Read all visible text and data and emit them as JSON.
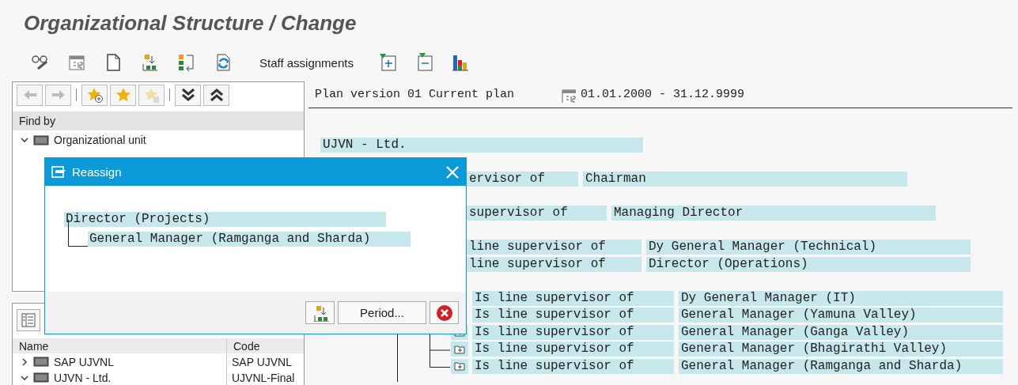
{
  "window": {
    "title": "Organizational Structure / Change"
  },
  "toolbar": {
    "staff_assignments": "Staff assignments"
  },
  "nav_buttons": [
    {
      "kind": "back",
      "disabled": true
    },
    {
      "kind": "forward",
      "disabled": true
    },
    {
      "kind": "add-favorite",
      "disabled": false
    },
    {
      "kind": "favorite",
      "disabled": false
    },
    {
      "kind": "delete-favorite",
      "disabled": true
    },
    {
      "kind": "expand-all",
      "disabled": false
    },
    {
      "kind": "collapse-all",
      "disabled": false
    }
  ],
  "find_by": {
    "header": "Find by",
    "items": [
      {
        "label": "Organizational unit",
        "expanded": true
      }
    ]
  },
  "results": {
    "columns": [
      "Name",
      "Code"
    ],
    "rows": [
      {
        "name": "SAP UJVNL",
        "code": "SAP UJVNL",
        "expanded": false
      },
      {
        "name": "UJVN - Ltd.",
        "code": "UJVNL-Final",
        "expanded": true
      }
    ]
  },
  "plan": {
    "label": "Plan version 01 Current plan",
    "period": "01.01.2000 - 31.12.9999"
  },
  "structure": {
    "label": "UJVN - Ltd.",
    "children": [
      {
        "kind": "cut",
        "relation": "ervisor of",
        "target": "Chairman",
        "children": [
          {
            "kind": "cut",
            "relation": "supervisor of",
            "target": "Managing Director",
            "children": [
              {
                "kind": "cut",
                "relation": "line supervisor of",
                "target": "Dy General Manager (Technical)"
              },
              {
                "kind": "cut",
                "relation": "line supervisor of",
                "target": "Director (Operations)",
                "children": [
                  {
                    "kind": "plain",
                    "relation": "Is line supervisor of",
                    "target": "Dy General Manager (IT)"
                  },
                  {
                    "kind": "plain",
                    "relation": "Is line supervisor of",
                    "target": "General Manager (Yamuna Valley)"
                  },
                  {
                    "kind": "folder",
                    "relation": "Is line supervisor of",
                    "target": "General Manager (Ganga Valley)"
                  },
                  {
                    "kind": "folder",
                    "relation": "Is line supervisor of",
                    "target": "General Manager (Bhagirathi Valley)"
                  },
                  {
                    "kind": "folder",
                    "relation": "Is line supervisor of",
                    "target": "General Manager (Ramganga and Sharda)"
                  }
                ]
              }
            ]
          }
        ]
      }
    ]
  },
  "dialog": {
    "title": "Reassign",
    "tree": {
      "label": "Director (Projects)",
      "children": [
        {
          "label": "General Manager (Ramganga and Sharda)"
        }
      ]
    },
    "buttons": [
      {
        "kind": "transfer"
      },
      {
        "kind": "text",
        "label": "Period..."
      },
      {
        "kind": "cancel"
      }
    ]
  }
}
